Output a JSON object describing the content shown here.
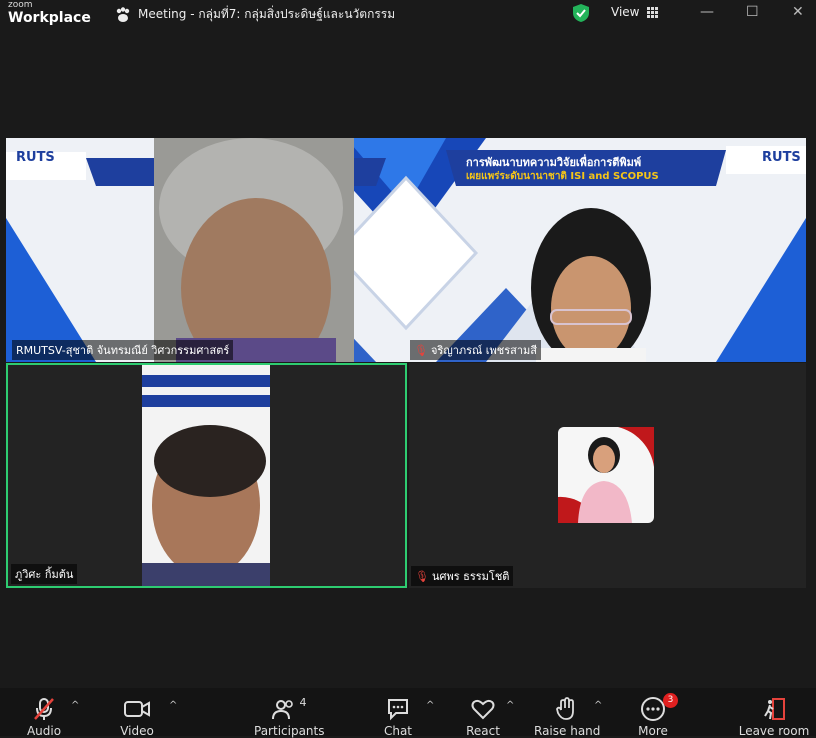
{
  "app": {
    "zoom": "zoom",
    "workplace": "Workplace"
  },
  "meeting_title": "Meeting - กลุ่มที่7: กลุ่มสิ่งประดิษฐ์และนวัตกรรม",
  "view_label": "View",
  "banner": {
    "logo_left": "RUTS",
    "logo_right": "RUTS",
    "line1": "การพัฒนาบทความวิจัยเพื่อการตีพิมพ์",
    "line2": "เผยแพร่ระดับนานาชาติ ISI and SCOPUS"
  },
  "participants": [
    {
      "name": "RMUTSV-สุชาติ จันทรมณีย์ วิศวกรรมศาสตร์",
      "muted": false
    },
    {
      "name": "จริญาภรณ์  เพชรสามสี",
      "muted": true
    },
    {
      "name": "ภูวิศะ กิ้มต้น",
      "muted": false
    },
    {
      "name": "นศพร ธรรมโชติ",
      "muted": true
    }
  ],
  "toolbar": {
    "audio": "Audio",
    "video": "Video",
    "participants": "Participants",
    "participants_count": "4",
    "chat": "Chat",
    "react": "React",
    "raise_hand": "Raise hand",
    "more": "More",
    "more_badge": "3",
    "leave": "Leave room"
  },
  "colors": {
    "active_speaker": "#2ecc71",
    "leave": "#e5433c",
    "badge": "#e02020"
  }
}
